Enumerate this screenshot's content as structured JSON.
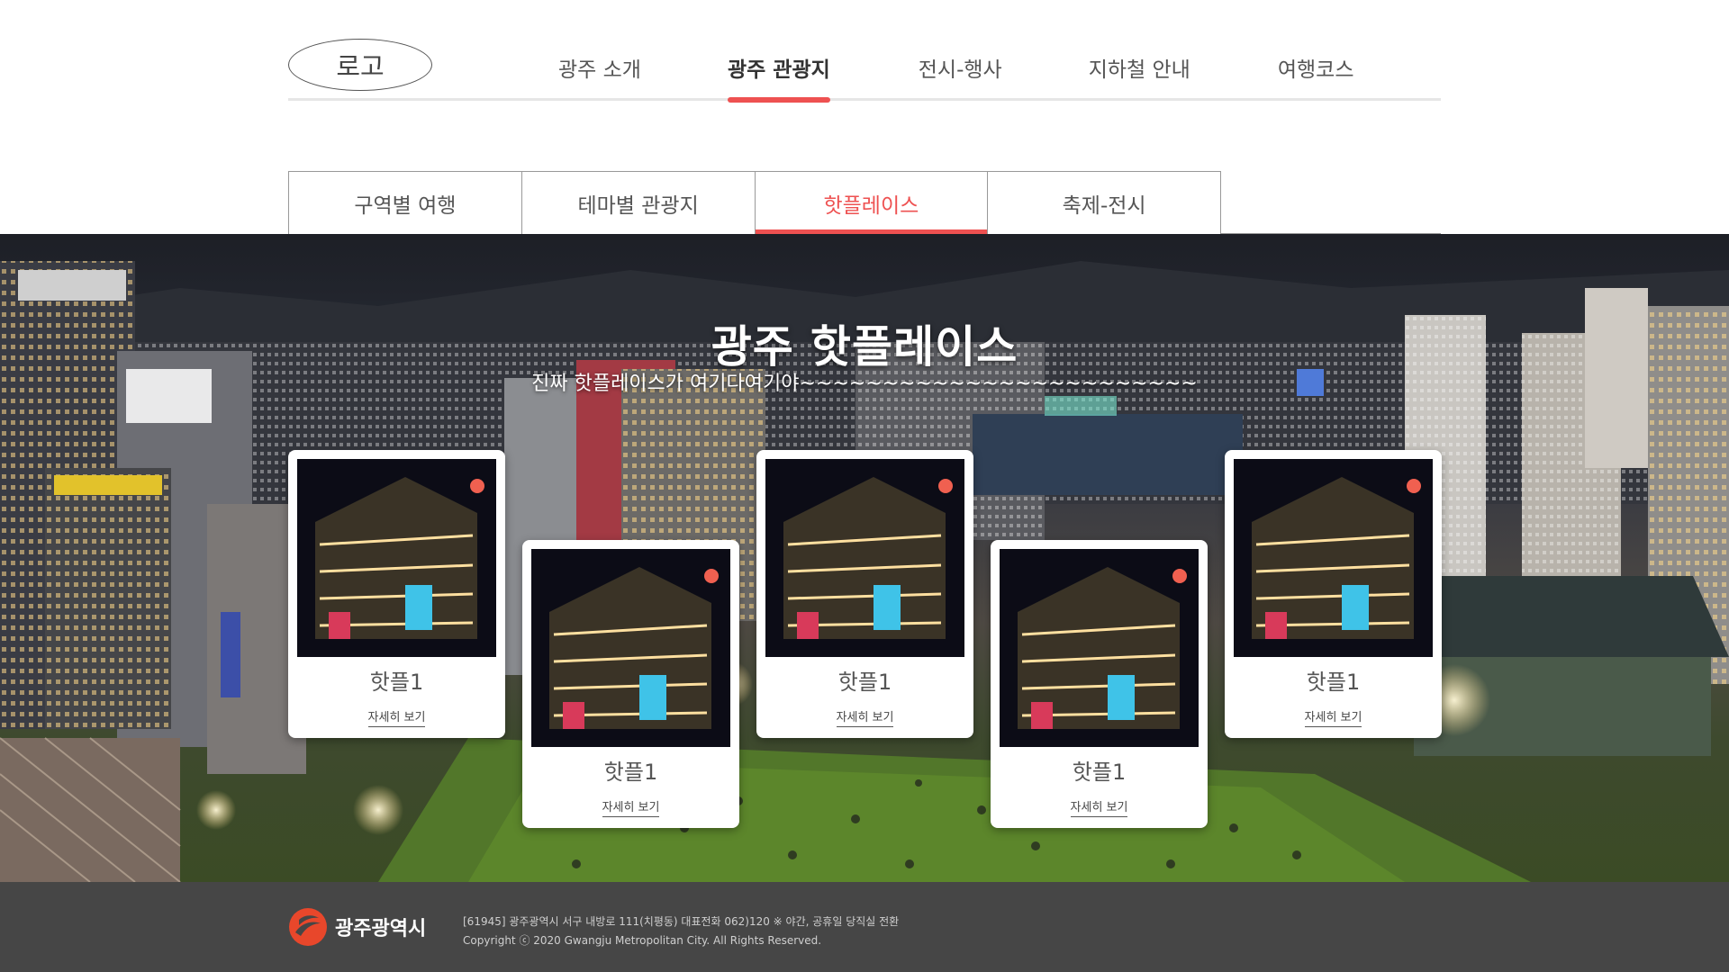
{
  "header": {
    "logo": "로고",
    "nav": [
      {
        "label": "광주 소개",
        "active": false
      },
      {
        "label": "광주 관광지",
        "active": true
      },
      {
        "label": "전시-행사",
        "active": false
      },
      {
        "label": "지하철 안내",
        "active": false
      },
      {
        "label": "여행코스",
        "active": false
      }
    ]
  },
  "subtabs": [
    {
      "label": "구역별 여행",
      "active": false
    },
    {
      "label": "테마별 관광지",
      "active": false
    },
    {
      "label": "핫플레이스",
      "active": true
    },
    {
      "label": "축제-전시",
      "active": false
    }
  ],
  "hero": {
    "title": "광주 핫플레이스",
    "subtitle": "진짜 핫플레이스가 여기다여기야~~~~~~~~~~~~~~~~~~~~~~~~"
  },
  "cards": [
    {
      "name": "핫플1",
      "more": "자세히 보기"
    },
    {
      "name": "핫플1",
      "more": "자세히 보기"
    },
    {
      "name": "핫플1",
      "more": "자세히 보기"
    },
    {
      "name": "핫플1",
      "more": "자세히 보기"
    },
    {
      "name": "핫플1",
      "more": "자세히 보기"
    }
  ],
  "footer": {
    "org_name": "광주광역시",
    "address": "[61945] 광주광역시 서구 내방로 111(치평동) 대표전화 062)120 ※ 야간, 공휴일 당직실 전환",
    "copyright": "Copyright ⓒ 2020 Gwangju Metropolitan City. All Rights Reserved."
  },
  "colors": {
    "accent": "#ee5151",
    "footer_bg": "#464646",
    "footer_logo": "#e8472b"
  }
}
